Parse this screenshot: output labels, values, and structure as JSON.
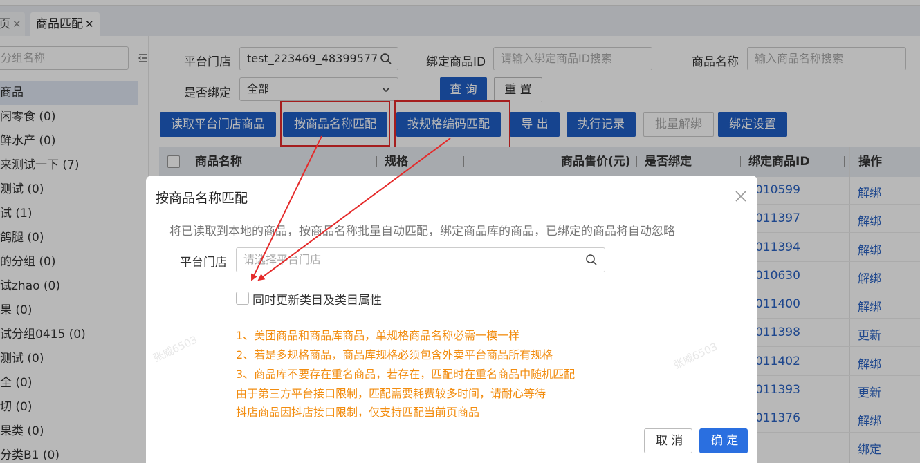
{
  "tabs": [
    {
      "label": "页",
      "close": "✕"
    },
    {
      "label": "商品匹配",
      "close": "✕"
    }
  ],
  "sidebar": {
    "search_placeholder": "分组名称",
    "collapse_icon": "collapse-left-icon",
    "items": [
      {
        "label": "商品"
      },
      {
        "label": "闲零食 (0)"
      },
      {
        "label": "鲜水产 (0)"
      },
      {
        "label": "来测试一下 (7)"
      },
      {
        "label": "测试 (0)"
      },
      {
        "label": "试 (1)"
      },
      {
        "label": "鸽腿 (0)"
      },
      {
        "label": "的分组 (0)"
      },
      {
        "label": "试zhao (0)"
      },
      {
        "label": "果 (0)"
      },
      {
        "label": "试分组0415 (0)"
      },
      {
        "label": "测试 (0)"
      },
      {
        "label": "全 (0)"
      },
      {
        "label": "切 (0)"
      },
      {
        "label": "果类 (0)"
      },
      {
        "label": "分类B1 (0)"
      }
    ]
  },
  "filters": {
    "store_label": "平台门店",
    "store_value": "test_223469_48399577",
    "bound_id_label": "绑定商品ID",
    "bound_id_placeholder": "请输入绑定商品ID搜索",
    "name_label": "商品名称",
    "name_placeholder": "输入商品名称搜索",
    "bound_label": "是否绑定",
    "bound_value": "全部",
    "query_label": "查 询",
    "reset_label": "重 置"
  },
  "toolbar": {
    "read_store": "读取平台门店商品",
    "match_by_name": "按商品名称匹配",
    "match_by_code": "按规格编码匹配",
    "export": "导 出",
    "exec_log": "执行记录",
    "batch_unbind": "批量解绑",
    "bind_settings": "绑定设置"
  },
  "table": {
    "columns": [
      "商品名称",
      "规格",
      "商品售价(元)",
      "是否绑定",
      "绑定商品ID",
      "操作"
    ],
    "rows": [
      {
        "id": "010599",
        "op": "解绑"
      },
      {
        "id": "011397",
        "op": "解绑"
      },
      {
        "id": "011394",
        "op": "解绑"
      },
      {
        "id": "010630",
        "op": "解绑"
      },
      {
        "id": "011400",
        "op": "解绑"
      },
      {
        "id": "011398",
        "op": "更新"
      },
      {
        "id": "011402",
        "op": "解绑"
      },
      {
        "id": "011393",
        "op": "更新"
      },
      {
        "id": "011376",
        "op": "解绑"
      },
      {
        "id": "",
        "op": "绑定"
      }
    ]
  },
  "modal": {
    "title": "按商品名称匹配",
    "description": "将已读取到本地的商品，按商品名称批量自动匹配，绑定商品库的商品，已绑定的商品将自动忽略",
    "store_label": "平台门店",
    "store_placeholder": "请选择平台门店",
    "checkbox_label": "同时更新类目及类目属性",
    "notes": [
      "1、美团商品和商品库商品，单规格商品名称必需一模一样",
      "2、若是多规格商品，商品库规格必须包含外卖平台商品所有规格",
      "3、商品库不要存在重名商品，若存在，匹配时在重名商品中随机匹配",
      "由于第三方平台接口限制，匹配需要耗费较多时间，请耐心等待",
      "抖店商品因抖店接口限制，仅支持匹配当前页商品"
    ],
    "cancel_label": "取 消",
    "ok_label": "确 定",
    "watermark": "张威6503",
    "note_color": "#f28c0f",
    "primary_color": "#2a6fe0"
  },
  "annotation_color": "#e52a2a"
}
